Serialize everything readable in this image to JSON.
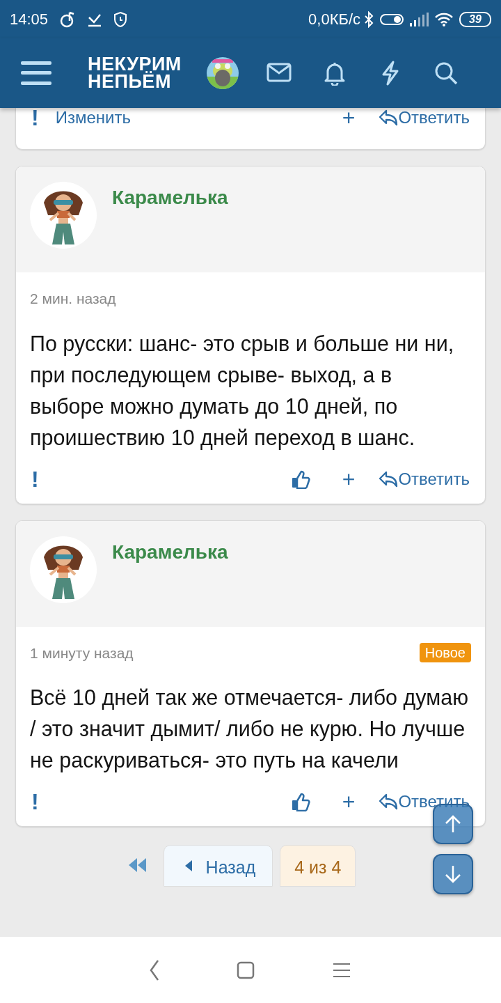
{
  "status_bar": {
    "time": "14:05",
    "network_speed": "0,0КБ/с",
    "battery": "39"
  },
  "header": {
    "logo_lines": [
      "НЕКУРИМ",
      "НЕПЬЁМ"
    ]
  },
  "posts": [
    {
      "partial": true,
      "actions": [
        {
          "kind": "report",
          "label": "!"
        },
        {
          "kind": "edit",
          "label": "Изменить"
        },
        {
          "kind": "plus",
          "label": "+"
        },
        {
          "kind": "reply",
          "label": "Ответить"
        }
      ]
    },
    {
      "partial": false,
      "author": "Карамелька",
      "time": "2 мин. назад",
      "text": "По русски: шанс- это срыв и больше ни ни, при последующем срыве- выход, а в выборе можно думать до 10 дней, по проишествию 10 дней переход в шанс.",
      "actions": [
        {
          "kind": "report",
          "label": "!"
        },
        {
          "kind": "like"
        },
        {
          "kind": "plus",
          "label": "+"
        },
        {
          "kind": "reply",
          "label": "Ответить"
        }
      ]
    },
    {
      "partial": false,
      "author": "Карамелька",
      "time": "1 минуту назад",
      "badge": "Новое",
      "text": "Всё 10 дней так же отмечается- либо думаю / это значит дымит/ либо не курю. Но лучше не раскуриваться- это путь на качели",
      "actions": [
        {
          "kind": "report",
          "label": "!"
        },
        {
          "kind": "like"
        },
        {
          "kind": "plus",
          "label": "+"
        },
        {
          "kind": "reply",
          "label": "Ответить"
        }
      ]
    }
  ],
  "pagination": {
    "prev_label": "Назад",
    "current": "4 из 4"
  }
}
